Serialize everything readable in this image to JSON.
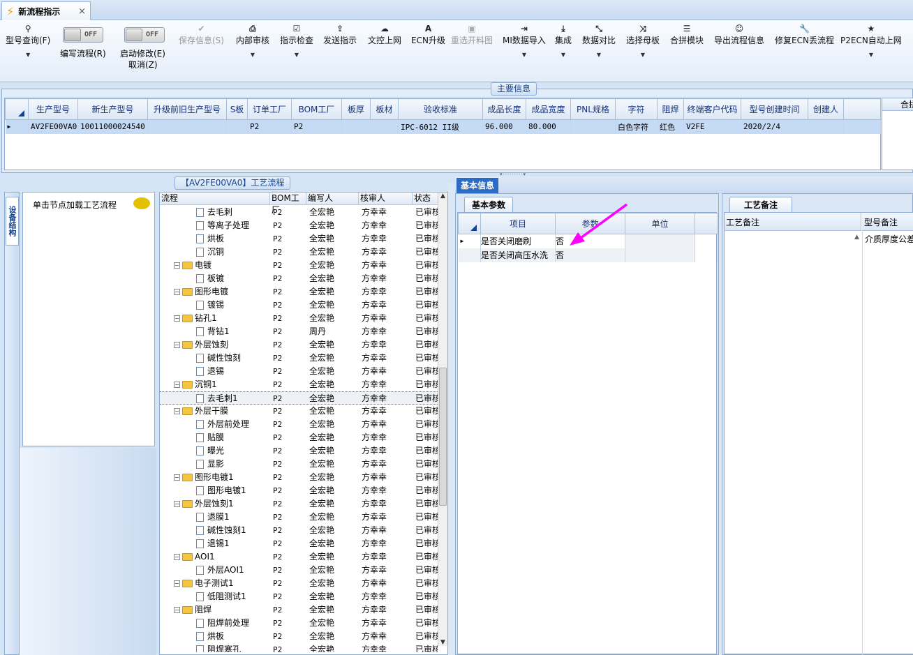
{
  "tab": {
    "title": "新流程指示",
    "close": "×"
  },
  "toolbar": {
    "query": "型号查询(F)",
    "edit_toggle": "OFF",
    "edit_label": "编写流程(R)",
    "start_toggle": "OFF",
    "start_label_1": "启动修改(E)",
    "start_label_2": "取消(Z)",
    "save": "保存信息(S)",
    "internal": "内部审核",
    "check": "指示检查",
    "send": "发送指示",
    "upload": "文控上网",
    "ecn": "ECN升级",
    "reselect": "重选开料图",
    "mi_import": "MI数据导入",
    "integrate": "集成",
    "compare": "数据对比",
    "mother": "选择母板",
    "merge": "合拼模块",
    "export": "导出流程信息",
    "repair": "修复ECN丢流程",
    "p2ecn": "P2ECN自动上网"
  },
  "main_info": {
    "title": "主要信息",
    "columns": [
      "生产型号",
      "新生产型号",
      "升级前旧生产型号",
      "S板",
      "订单工厂",
      "BOM工厂",
      "板厚",
      "板材",
      "验收标准",
      "成品长度",
      "成品宽度",
      "PNL规格",
      "字符",
      "阻焊",
      "终端客户代码",
      "型号创建时间",
      "创建人"
    ],
    "row": [
      "AV2FE00VA0",
      "10011000024540",
      "",
      "",
      "P2",
      "P2",
      "",
      "",
      "IPC-6012 II级",
      "96.000",
      "80.000",
      "",
      "白色字符",
      "红色",
      "V2FE",
      "2020/2/4",
      ""
    ],
    "right_header": "合拼"
  },
  "side": {
    "tab": "设备结构",
    "hint": "单击节点加载工艺流程"
  },
  "flow": {
    "title": "【AV2FE00VA0】工艺流程",
    "headers": [
      "流程",
      "BOM工厂",
      "编写人",
      "核审人",
      "状态"
    ],
    "rows": [
      {
        "name": "去毛刺",
        "lvl": 2,
        "f": "P2",
        "w": "全宏艳",
        "r": "方幸幸",
        "s": "已审核"
      },
      {
        "name": "等离子处理",
        "lvl": 2,
        "f": "P2",
        "w": "全宏艳",
        "r": "方幸幸",
        "s": "已审核"
      },
      {
        "name": "烘板",
        "lvl": 2,
        "f": "P2",
        "w": "全宏艳",
        "r": "方幸幸",
        "s": "已审核"
      },
      {
        "name": "沉铜",
        "lvl": 2,
        "f": "P2",
        "w": "全宏艳",
        "r": "方幸幸",
        "s": "已审核"
      },
      {
        "name": "电镀",
        "lvl": 1,
        "f": "P2",
        "w": "全宏艳",
        "r": "方幸幸",
        "s": "已审核"
      },
      {
        "name": "板镀",
        "lvl": 2,
        "f": "P2",
        "w": "全宏艳",
        "r": "方幸幸",
        "s": "已审核"
      },
      {
        "name": "图形电镀",
        "lvl": 1,
        "f": "P2",
        "w": "全宏艳",
        "r": "方幸幸",
        "s": "已审核"
      },
      {
        "name": "镀锡",
        "lvl": 2,
        "f": "P2",
        "w": "全宏艳",
        "r": "方幸幸",
        "s": "已审核"
      },
      {
        "name": "钻孔1",
        "lvl": 1,
        "f": "P2",
        "w": "全宏艳",
        "r": "方幸幸",
        "s": "已审核"
      },
      {
        "name": "背钻1",
        "lvl": 2,
        "f": "P2",
        "w": "周丹",
        "r": "方幸幸",
        "s": "已审核"
      },
      {
        "name": "外层蚀刻",
        "lvl": 1,
        "f": "P2",
        "w": "全宏艳",
        "r": "方幸幸",
        "s": "已审核"
      },
      {
        "name": "碱性蚀刻",
        "lvl": 2,
        "f": "P2",
        "w": "全宏艳",
        "r": "方幸幸",
        "s": "已审核"
      },
      {
        "name": "退锡",
        "lvl": 2,
        "f": "P2",
        "w": "全宏艳",
        "r": "方幸幸",
        "s": "已审核"
      },
      {
        "name": "沉铜1",
        "lvl": 1,
        "f": "P2",
        "w": "全宏艳",
        "r": "方幸幸",
        "s": "已审核"
      },
      {
        "name": "去毛刺1",
        "lvl": 2,
        "f": "P2",
        "w": "全宏艳",
        "r": "方幸幸",
        "s": "已审核",
        "sel": true
      },
      {
        "name": "外层干膜",
        "lvl": 1,
        "f": "P2",
        "w": "全宏艳",
        "r": "方幸幸",
        "s": "已审核"
      },
      {
        "name": "外层前处理",
        "lvl": 2,
        "f": "P2",
        "w": "全宏艳",
        "r": "方幸幸",
        "s": "已审核"
      },
      {
        "name": "贴膜",
        "lvl": 2,
        "f": "P2",
        "w": "全宏艳",
        "r": "方幸幸",
        "s": "已审核"
      },
      {
        "name": "曝光",
        "lvl": 2,
        "f": "P2",
        "w": "全宏艳",
        "r": "方幸幸",
        "s": "已审核"
      },
      {
        "name": "显影",
        "lvl": 2,
        "f": "P2",
        "w": "全宏艳",
        "r": "方幸幸",
        "s": "已审核"
      },
      {
        "name": "图形电镀1",
        "lvl": 1,
        "f": "P2",
        "w": "全宏艳",
        "r": "方幸幸",
        "s": "已审核"
      },
      {
        "name": "图形电镀1",
        "lvl": 2,
        "f": "P2",
        "w": "全宏艳",
        "r": "方幸幸",
        "s": "已审核"
      },
      {
        "name": "外层蚀刻1",
        "lvl": 1,
        "f": "P2",
        "w": "全宏艳",
        "r": "方幸幸",
        "s": "已审核"
      },
      {
        "name": "退膜1",
        "lvl": 2,
        "f": "P2",
        "w": "全宏艳",
        "r": "方幸幸",
        "s": "已审核"
      },
      {
        "name": "碱性蚀刻1",
        "lvl": 2,
        "f": "P2",
        "w": "全宏艳",
        "r": "方幸幸",
        "s": "已审核"
      },
      {
        "name": "退锡1",
        "lvl": 2,
        "f": "P2",
        "w": "全宏艳",
        "r": "方幸幸",
        "s": "已审核"
      },
      {
        "name": "AOI1",
        "lvl": 1,
        "f": "P2",
        "w": "全宏艳",
        "r": "方幸幸",
        "s": "已审核"
      },
      {
        "name": "外层AOI1",
        "lvl": 2,
        "f": "P2",
        "w": "全宏艳",
        "r": "方幸幸",
        "s": "已审核"
      },
      {
        "name": "电子测试1",
        "lvl": 1,
        "f": "P2",
        "w": "全宏艳",
        "r": "方幸幸",
        "s": "已审核"
      },
      {
        "name": "低阻测试1",
        "lvl": 2,
        "f": "P2",
        "w": "全宏艳",
        "r": "方幸幸",
        "s": "已审核"
      },
      {
        "name": "阻焊",
        "lvl": 1,
        "f": "P2",
        "w": "全宏艳",
        "r": "方幸幸",
        "s": "已审核"
      },
      {
        "name": "阻焊前处理",
        "lvl": 2,
        "f": "P2",
        "w": "全宏艳",
        "r": "方幸幸",
        "s": "已审核"
      },
      {
        "name": "烘板",
        "lvl": 2,
        "f": "P2",
        "w": "全宏艳",
        "r": "方幸幸",
        "s": "已审核"
      },
      {
        "name": "阻焊塞孔",
        "lvl": 2,
        "f": "P2",
        "w": "全宏艳",
        "r": "方幸幸",
        "s": "已审核"
      }
    ]
  },
  "basic": {
    "tab": "基本信息",
    "subtab": "基本参数",
    "headers": [
      "项目",
      "参数",
      "单位"
    ],
    "rows": [
      {
        "item": "是否关闭磨刷",
        "val": "否",
        "unit": ""
      },
      {
        "item": "是否关闭高压水洗",
        "val": "否",
        "unit": ""
      }
    ]
  },
  "remark": {
    "tab": "工艺备注",
    "headers": [
      "工艺备注",
      "型号备注"
    ],
    "model_note": "介质厚度公差"
  },
  "colors": {
    "accent": "#15428b",
    "arrow": "#ff00ff"
  }
}
